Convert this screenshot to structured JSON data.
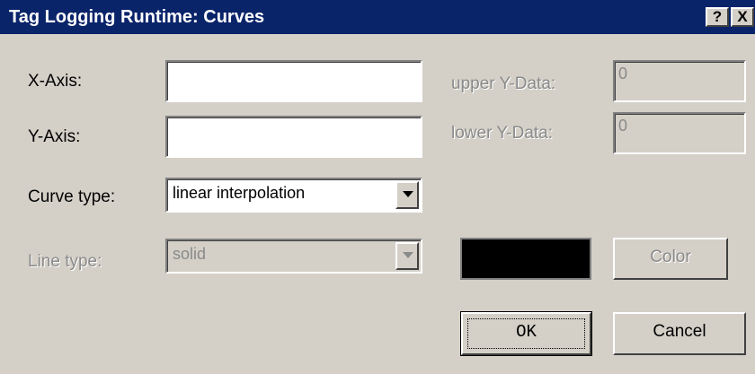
{
  "window": {
    "title": "Tag Logging Runtime: Curves",
    "help_glyph": "?",
    "close_glyph": "X"
  },
  "form": {
    "x_axis": {
      "label": "X-Axis:",
      "value": ""
    },
    "y_axis": {
      "label": "Y-Axis:",
      "value": ""
    },
    "upper_y": {
      "label": "upper Y-Data:",
      "value": "0",
      "enabled": false
    },
    "lower_y": {
      "label": "lower Y-Data:",
      "value": "0",
      "enabled": false
    },
    "curve_type": {
      "label": "Curve type:",
      "value": "linear interpolation"
    },
    "line_type": {
      "label": "Line type:",
      "value": "solid",
      "enabled": false
    },
    "color": {
      "swatch": "#000000",
      "button_label": "Color",
      "enabled": false
    }
  },
  "buttons": {
    "ok": "OK",
    "cancel": "Cancel"
  }
}
